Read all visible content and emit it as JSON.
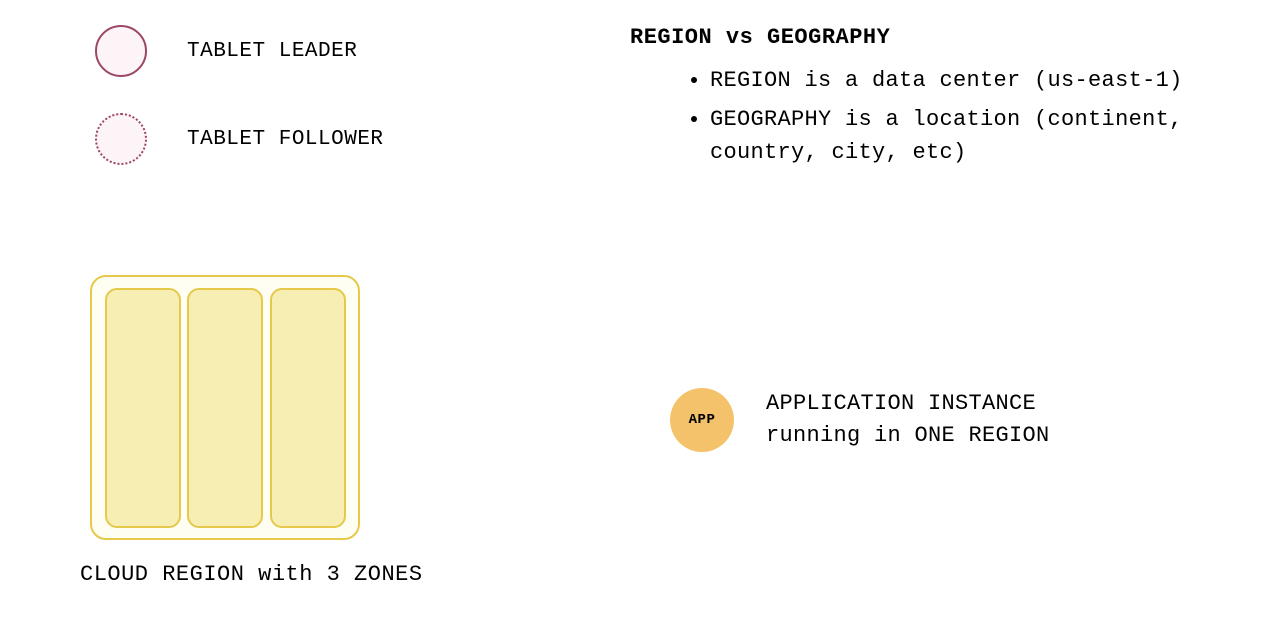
{
  "legend": {
    "tablet_leader": "TABLET LEADER",
    "tablet_follower": "TABLET FOLLOWER"
  },
  "comparison": {
    "title": "REGION vs GEOGRAPHY",
    "items": [
      "REGION is a data center (us-east-1)",
      "GEOGRAPHY is a location (continent, country, city, etc)"
    ]
  },
  "cloud_region": {
    "caption": "CLOUD REGION with 3 ZONES",
    "zone_count": 3
  },
  "app": {
    "badge": "APP",
    "line1": "APPLICATION INSTANCE",
    "line2": "running in ONE REGION"
  },
  "colors": {
    "tablet_border": "#9c4668",
    "tablet_fill": "#fdf4f8",
    "region_border": "#e6c94a",
    "region_fill": "#fffef2",
    "zone_fill": "#f7eeb3",
    "app_fill": "#f4c26a"
  }
}
